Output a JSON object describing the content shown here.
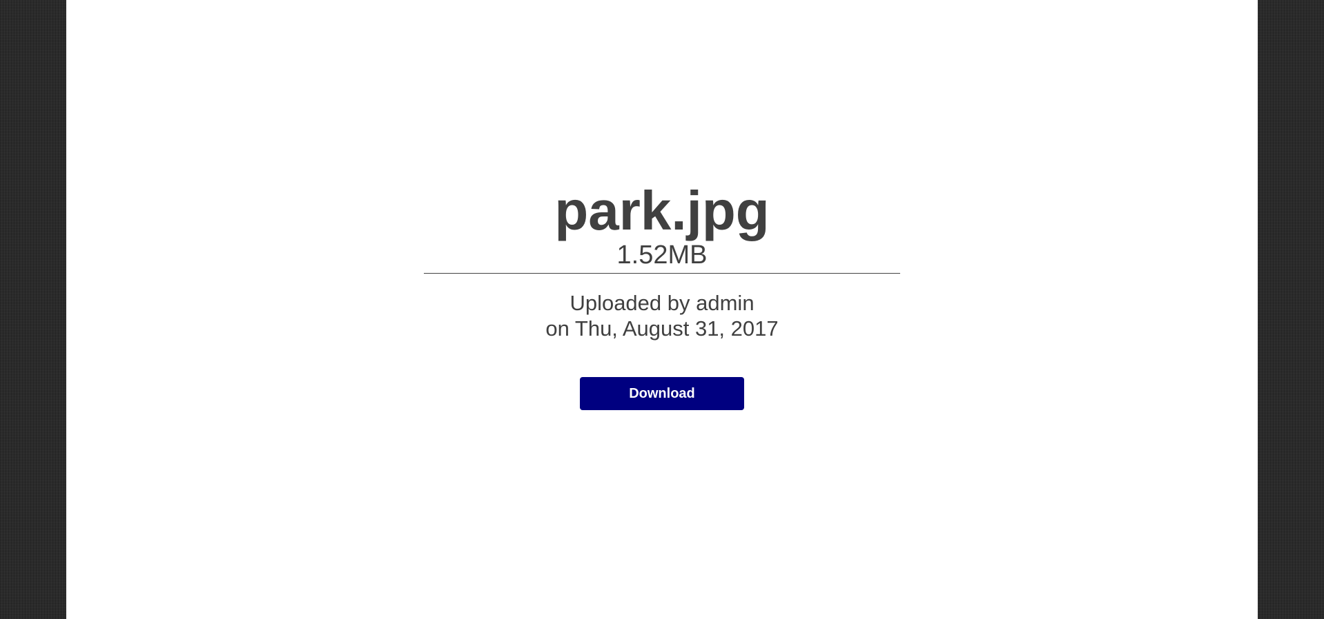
{
  "file": {
    "name": "park.jpg",
    "size": "1.52MB"
  },
  "upload": {
    "by_line": "Uploaded by admin",
    "date_line": "on Thu, August 31, 2017"
  },
  "actions": {
    "download_label": "Download"
  },
  "colors": {
    "background": "#2b2b2b",
    "panel": "#ffffff",
    "text": "#404040",
    "button": "#000080",
    "button_text": "#ffffff"
  }
}
